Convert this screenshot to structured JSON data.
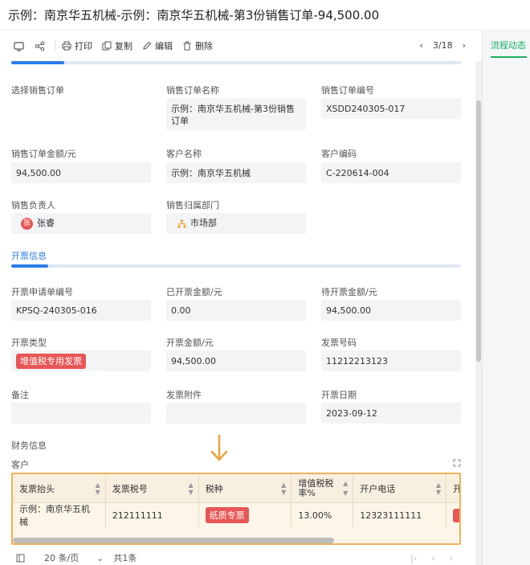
{
  "header": {
    "title": "示例：南京华五机械-示例：南京华五机械-第3份销售订单-94,500.00"
  },
  "toolbar": {
    "print": "打印",
    "copy": "复制",
    "edit": "编辑",
    "delete": "删除",
    "pager": "3/18"
  },
  "right_panel": {
    "tab": "流程动态"
  },
  "order": {
    "select_label": "选择销售订单",
    "name_label": "销售订单名称",
    "name_value": "示例：南京华五机械-第3份销售订单",
    "number_label": "销售订单编号",
    "number_value": "XSDD240305-017",
    "amount_label": "销售订单金额/元",
    "amount_value": "94,500.00",
    "customer_label": "客户名称",
    "customer_value": "示例：南京华五机械",
    "customer_code_label": "客户编码",
    "customer_code_value": "C-220614-004",
    "owner_label": "销售负责人",
    "owner_avatar": "张",
    "owner_value": "张睿",
    "dept_label": "销售归属部门",
    "dept_value": "市场部"
  },
  "invoice": {
    "section_title": "开票信息",
    "req_no_label": "开票申请单编号",
    "req_no_value": "KPSQ-240305-016",
    "invoiced_label": "已开票金额/元",
    "invoiced_value": "0.00",
    "pending_label": "待开票金额/元",
    "pending_value": "94,500.00",
    "type_label": "开票类型",
    "type_value": "增值税专用发票",
    "amount_label": "开票金额/元",
    "amount_value": "94,500.00",
    "number_label": "发票号码",
    "number_value": "11212213123",
    "remark_label": "备注",
    "attach_label": "发票附件",
    "date_label": "开票日期",
    "date_value": "2023-09-12"
  },
  "finance": {
    "section_title": "财务信息",
    "customer_label": "客户",
    "columns": [
      "发票抬头",
      "发票税号",
      "税种",
      "增值税税率%",
      "开户电话",
      "开"
    ],
    "row": {
      "title": "示例：南京华五机械",
      "tax_no": "212111111",
      "tax_type": "纸质专票",
      "rate": "13.00%",
      "phone": "12323111111"
    },
    "footer": {
      "page_size": "20 条/页",
      "total": "共1条"
    }
  }
}
